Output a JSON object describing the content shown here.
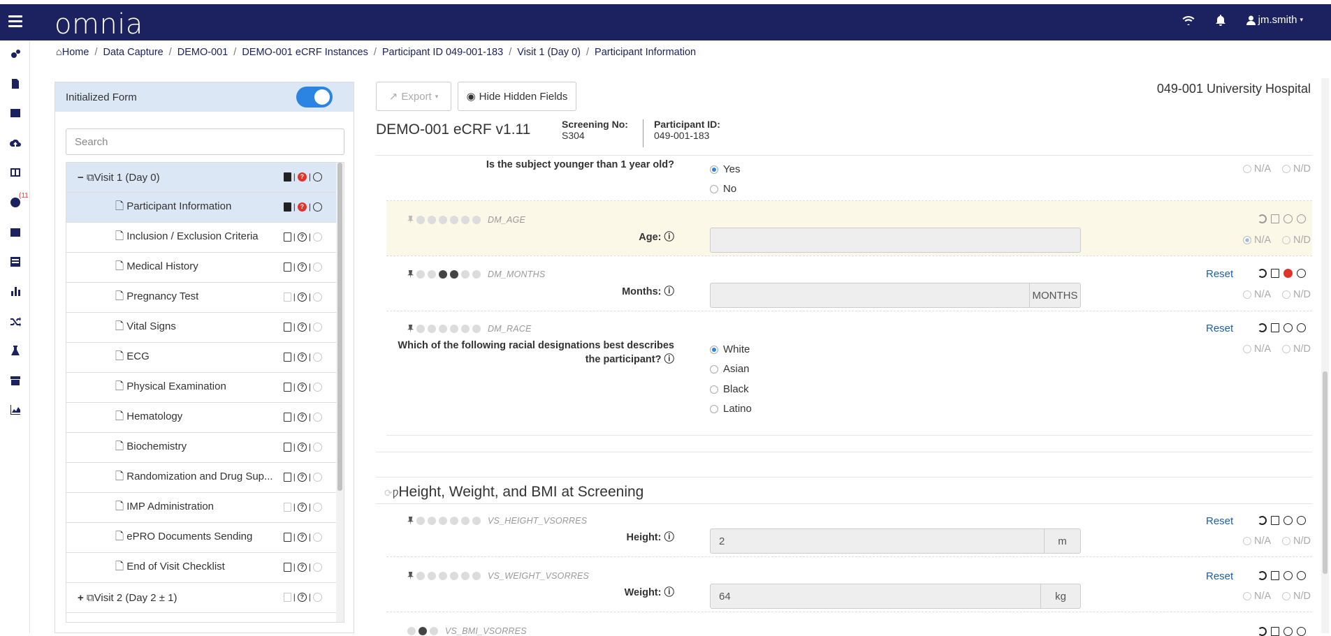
{
  "app": {
    "logo_text": "omnia",
    "user": "jm.smith",
    "brand_color": "#1c2260",
    "accent_color": "#2b84e1"
  },
  "sidenav": {
    "help_badge": "(11"
  },
  "breadcrumb": [
    "Home",
    "Data Capture",
    "DEMO-001",
    "DEMO-001 eCRF Instances",
    "Participant ID 049-001-183",
    "Visit 1 (Day 0)",
    "Participant Information"
  ],
  "left": {
    "header": "Initialized Form",
    "search_placeholder": "Search",
    "visit1": "Visit 1 (Day 0)",
    "forms": [
      "Participant Information",
      "Inclusion / Exclusion Criteria",
      "Medical History",
      "Pregnancy Test",
      "Vital Signs",
      "ECG",
      "Physical Examination",
      "Hematology",
      "Biochemistry",
      "Randomization and Drug Sup...",
      "IMP Administration",
      "ePRO Documents Sending",
      "End of Visit Checklist"
    ],
    "visit2": "Visit 2 (Day 2 ± 1)"
  },
  "toolbar": {
    "export": "Export",
    "hide_hidden": "Hide Hidden Fields",
    "site": "049-001 University Hospital"
  },
  "form": {
    "title": "DEMO-001 eCRF v1.11",
    "screening_label": "Screening No:",
    "screening_value": "S304",
    "participant_label": "Participant ID:",
    "participant_value": "049-001-183"
  },
  "common": {
    "na": "N/A",
    "nd": "N/D",
    "reset": "Reset"
  },
  "q_young": {
    "label": "Is the subject younger than 1 year old?",
    "yes": "Yes",
    "no": "No"
  },
  "q_age": {
    "code": "DM_AGE",
    "label": "Age:"
  },
  "q_months": {
    "code": "DM_MONTHS",
    "label": "Months:",
    "unit": "MONTHS"
  },
  "q_race": {
    "code": "DM_RACE",
    "label1": "Which of the following racial designations best describes",
    "label2": "the participant?",
    "options": [
      "White",
      "Asian",
      "Black",
      "Latino"
    ]
  },
  "section": {
    "title": "Height, Weight, and BMI at Screening"
  },
  "q_height": {
    "code": "VS_HEIGHT_VSORRES",
    "label": "Height:",
    "value": "2",
    "unit": "m"
  },
  "q_weight": {
    "code": "VS_WEIGHT_VSORRES",
    "label": "Weight:",
    "value": "64",
    "unit": "kg"
  },
  "q_bmi": {
    "code": "VS_BMI_VSORRES"
  }
}
